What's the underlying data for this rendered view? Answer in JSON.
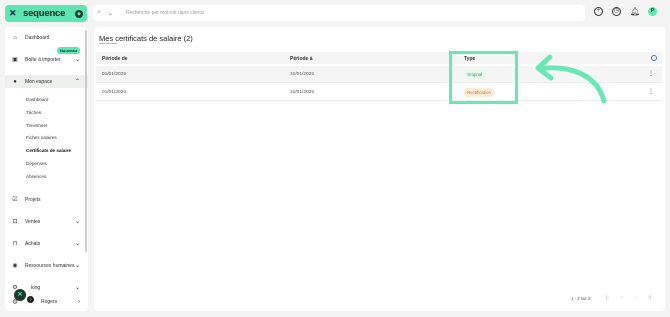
{
  "header": {
    "logo_text": "sequence",
    "search_placeholder": "Recherche par mot-clé dans clients"
  },
  "sidebar": {
    "items": [
      {
        "label": "Dashboard",
        "icon": "home-icon"
      },
      {
        "label": "Boîte à importer",
        "icon": "inbox-icon"
      },
      {
        "label": "Mon espace",
        "icon": "user-icon"
      },
      {
        "label": "Projets",
        "icon": "check-square-icon"
      },
      {
        "label": "Ventes",
        "icon": "lock-icon"
      },
      {
        "label": "Achats",
        "icon": "bag-icon"
      },
      {
        "label": "Ressources humaines",
        "icon": "people-icon"
      },
      {
        "label": "king",
        "icon": "settings-icon"
      },
      {
        "label": "Rogers",
        "icon": "avatar-icon"
      }
    ],
    "badge": "Nouveau",
    "subitems": [
      "Dashboard",
      "Tâches",
      "Timesheet",
      "Fiches salaires",
      "Certificats de salaire",
      "Dépenses",
      "Absences"
    ]
  },
  "main": {
    "title": "Mes certificats de salaire (2)",
    "columns": [
      "Période de",
      "Période à",
      "Type"
    ],
    "rows": [
      {
        "from": "01/01/2025",
        "to": "31/01/2025",
        "type": "Original"
      },
      {
        "from": "01/01/2025",
        "to": "31/01/2025",
        "type": "Rectification"
      }
    ],
    "pagination": "1 - 2 sur 2"
  },
  "colors": {
    "accent": "#5fe5b4",
    "original": "#2e9c55",
    "rectification": "#c27a1e"
  }
}
